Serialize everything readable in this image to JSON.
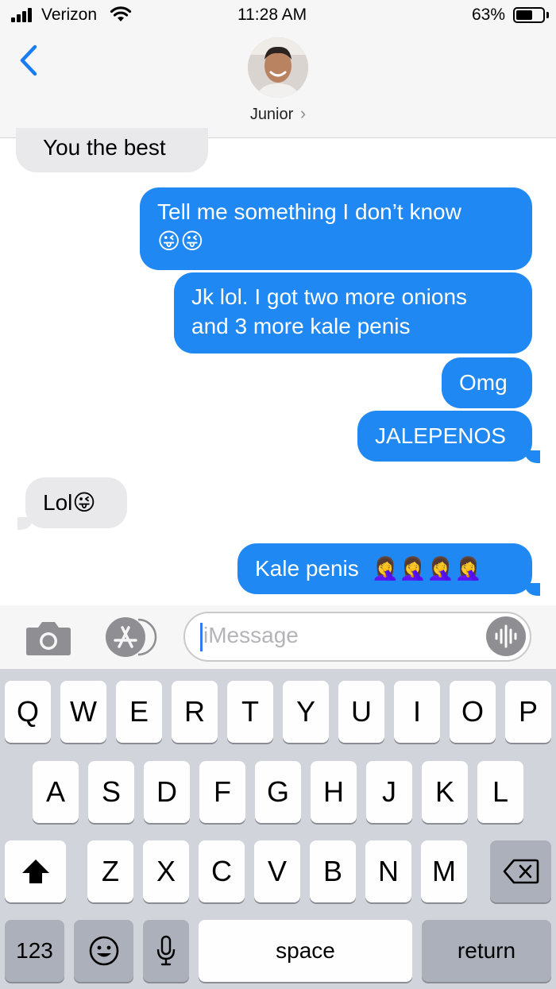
{
  "status_bar": {
    "carrier": "Verizon",
    "time": "11:28 AM",
    "battery_percent": "63%",
    "battery_level": 0.63
  },
  "header": {
    "contact_name": "Junior",
    "chevron": "›"
  },
  "messages": [
    {
      "side": "received",
      "text": "You the best"
    },
    {
      "side": "sent",
      "text": "Tell me something I don’t know",
      "emoji": "😜😜"
    },
    {
      "side": "sent",
      "text": "Jk lol. I got two more onions",
      "text2": "and 3 more kale penis"
    },
    {
      "side": "sent",
      "text": "Omg"
    },
    {
      "side": "sent",
      "text": "JALEPENOS"
    },
    {
      "side": "received",
      "text": "Lol",
      "emoji": "😜"
    },
    {
      "side": "sent",
      "text": "Kale penis",
      "emoji": "🤦‍♀️🤦‍♀️🤦‍♀️🤦‍♀️"
    }
  ],
  "input": {
    "placeholder": "iMessage"
  },
  "keyboard": {
    "row1": [
      "Q",
      "W",
      "E",
      "R",
      "T",
      "Y",
      "U",
      "I",
      "O",
      "P"
    ],
    "row2": [
      "A",
      "S",
      "D",
      "F",
      "G",
      "H",
      "J",
      "K",
      "L"
    ],
    "row3": [
      "Z",
      "X",
      "C",
      "V",
      "B",
      "N",
      "M"
    ],
    "numbers_label": "123",
    "space_label": "space",
    "return_label": "return"
  },
  "colors": {
    "sent_bubble": "#1f88f2",
    "received_bubble": "#e9e9eb",
    "accent": "#3478f6"
  },
  "icons": [
    "signal-icon",
    "wifi-icon",
    "battery-icon",
    "back-chevron-icon",
    "camera-icon",
    "app-store-icon",
    "audio-wave-icon",
    "shift-icon",
    "backspace-icon",
    "emoji-icon",
    "microphone-icon"
  ]
}
